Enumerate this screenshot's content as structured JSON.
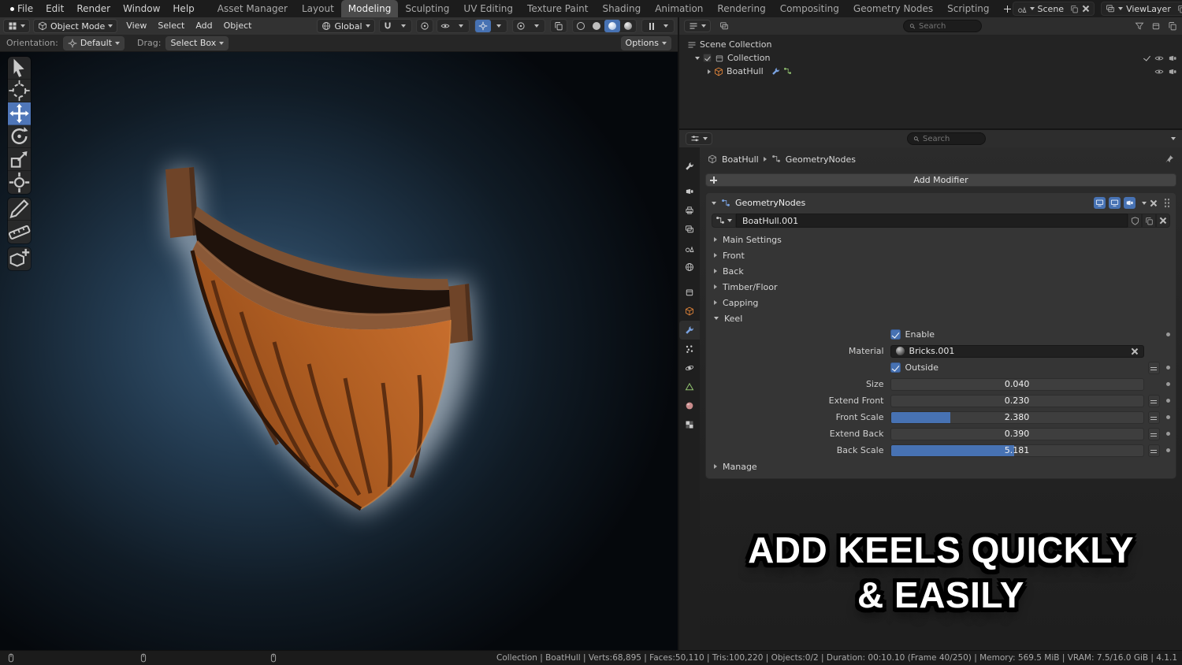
{
  "colors": {
    "accent_blue": "#4772b3",
    "object_orange": "#e8883a",
    "data_green": "#8fbf6e"
  },
  "topbar": {
    "menus": [
      "File",
      "Edit",
      "Render",
      "Window",
      "Help"
    ],
    "tabs": [
      "Asset Manager",
      "Layout",
      "Modeling",
      "Sculpting",
      "UV Editing",
      "Texture Paint",
      "Shading",
      "Animation",
      "Rendering",
      "Compositing",
      "Geometry Nodes",
      "Scripting"
    ],
    "active_tab": "Modeling",
    "scene_label": "Scene",
    "viewlayer_label": "ViewLayer"
  },
  "viewport": {
    "mode": "Object Mode",
    "menus": [
      "View",
      "Select",
      "Add",
      "Object"
    ],
    "orientation": "Global",
    "tool_settings": {
      "orientation_label": "Orientation:",
      "orientation_value": "Default",
      "drag_label": "Drag:",
      "drag_value": "Select Box",
      "options_label": "Options"
    }
  },
  "outliner": {
    "search_placeholder": "Search",
    "rows": [
      {
        "label": "Scene Collection"
      },
      {
        "label": "Collection"
      },
      {
        "label": "BoatHull"
      }
    ]
  },
  "properties": {
    "search_placeholder": "Search",
    "breadcrumb": {
      "object": "BoatHull",
      "modifier": "GeometryNodes"
    },
    "add_modifier_label": "Add Modifier",
    "modifier": {
      "name": "GeometryNodes",
      "node_group": "BoatHull.001",
      "sections": [
        "Main Settings",
        "Front",
        "Back",
        "Timber/Floor",
        "Capping"
      ],
      "keel_section": "Keel",
      "manage_section": "Manage",
      "keel": {
        "enable_label": "Enable",
        "material_label": "Material",
        "material_value": "Bricks.001",
        "outside_label": "Outside",
        "sliders": [
          {
            "label": "Size",
            "value": "0.040",
            "fill": 0
          },
          {
            "label": "Extend Front",
            "value": "0.230",
            "fill": 0
          },
          {
            "label": "Front Scale",
            "value": "2.380",
            "fill": 23.5
          },
          {
            "label": "Extend Back",
            "value": "0.390",
            "fill": 0
          },
          {
            "label": "Back Scale",
            "value": "5.181",
            "fill": 49
          }
        ]
      }
    }
  },
  "overlay": {
    "line1": "ADD KEELS QUICKLY",
    "line2": "& EASILY"
  },
  "statusbar": {
    "stats": "Collection | BoatHull | Verts:68,895 | Faces:50,110 | Tris:100,220 | Objects:0/2 | Duration: 00:10.10 (Frame 40/250) | Memory: 569.5 MiB | VRAM: 7.5/16.0 GiB | 4.1.1"
  }
}
